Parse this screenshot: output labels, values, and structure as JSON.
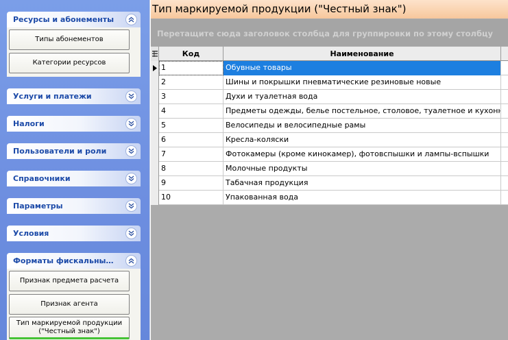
{
  "sidebar": {
    "groups": [
      {
        "title": "Ресурсы и абонементы",
        "expanded": true,
        "items": [
          "Типы абонементов",
          "Категории ресурсов"
        ]
      },
      {
        "title": "Услуги и платежи",
        "expanded": false
      },
      {
        "title": "Налоги",
        "expanded": false
      },
      {
        "title": "Пользователи и роли",
        "expanded": false
      },
      {
        "title": "Справочники",
        "expanded": false
      },
      {
        "title": "Параметры",
        "expanded": false
      },
      {
        "title": "Условия",
        "expanded": false
      },
      {
        "title": "Форматы фискальных документов",
        "expanded": true,
        "items": [
          "Признак предмета расчета",
          "Признак агента",
          "Тип маркируемой продукции (\"Честный знак\")"
        ],
        "active_item": "Тип маркируемой продукции (\"Честный знак\")"
      }
    ]
  },
  "main": {
    "title": "Тип маркируемой продукции (\"Честный знак\")",
    "group_panel_hint": "Перетащите сюда заголовок столбца для группировки по этому столбцу",
    "table": {
      "columns": [
        "Код",
        "Наименование"
      ],
      "selected_row": 0,
      "rows": [
        {
          "code": "1",
          "name": "Обувные товары"
        },
        {
          "code": "2",
          "name": "Шины и покрышки пневматические резиновые новые"
        },
        {
          "code": "3",
          "name": "Духи и туалетная вода"
        },
        {
          "code": "4",
          "name": "Предметы одежды, белье постельное, столовое, туалетное и кухонное"
        },
        {
          "code": "5",
          "name": "Велосипеды и велосипедные рамы"
        },
        {
          "code": "6",
          "name": "Кресла-коляски"
        },
        {
          "code": "7",
          "name": "Фотокамеры (кроме кинокамер), фотовспышки и лампы-вспышки"
        },
        {
          "code": "8",
          "name": "Молочные продукты"
        },
        {
          "code": "9",
          "name": "Табачная продукция"
        },
        {
          "code": "10",
          "name": "Упакованная вода"
        }
      ]
    }
  },
  "colors": {
    "sidebar_bg": "#6d8ee0",
    "group_title": "#1c4aa8",
    "title_bar": "#f7c79c",
    "selection": "#1d7fe0",
    "active_underline": "#45c234"
  },
  "icons": {
    "collapse": "double-chevron-up-icon",
    "expand": "double-chevron-down-icon",
    "row_pointer": "row-pointer-icon",
    "column_chooser": "column-chooser-icon"
  }
}
